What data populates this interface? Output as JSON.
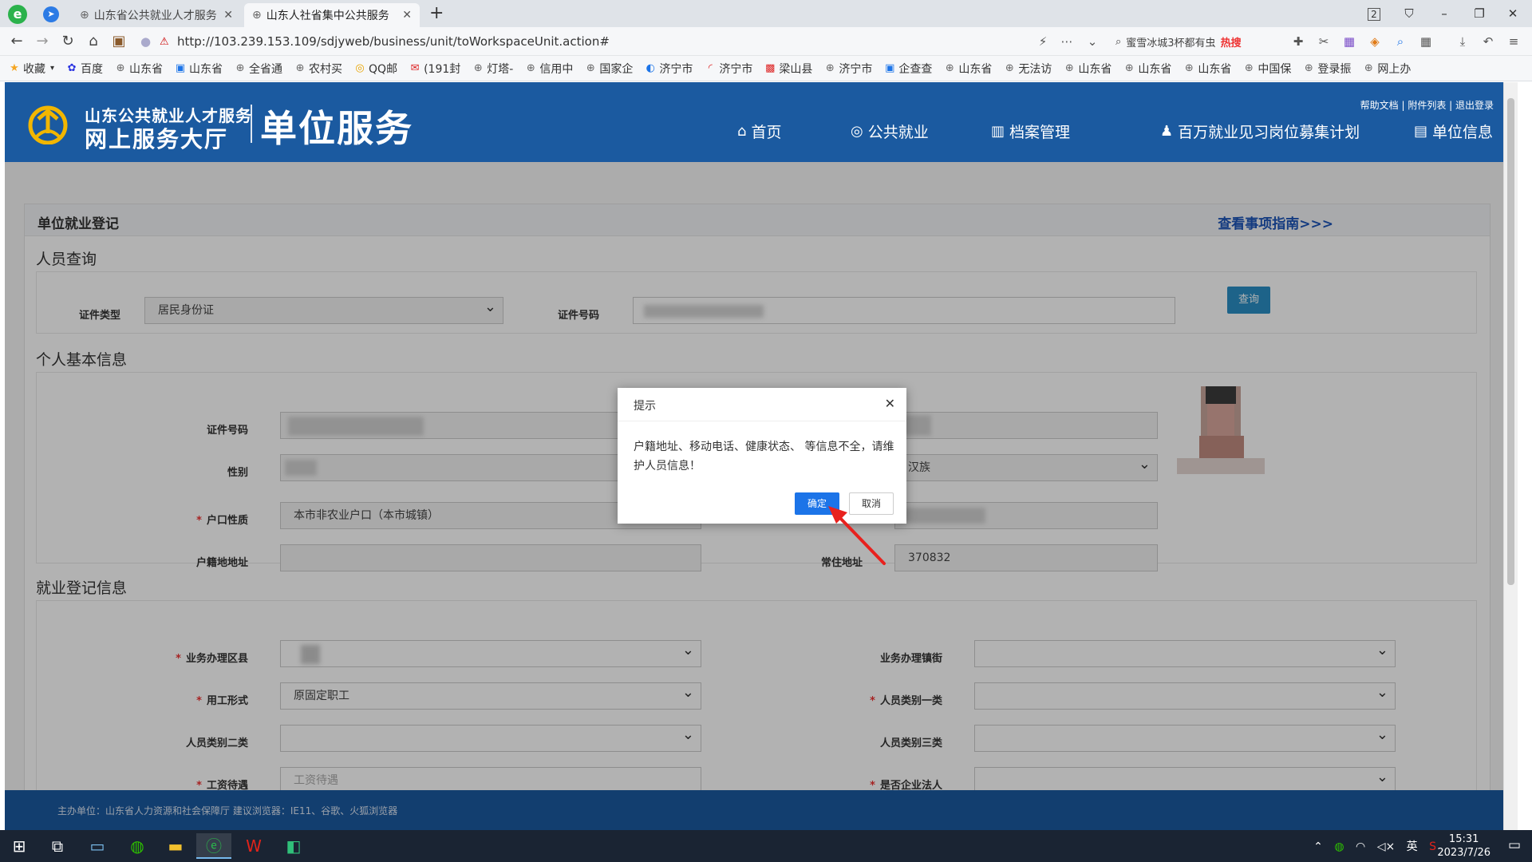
{
  "browser": {
    "tabs": [
      {
        "title": "山东省公共就业人才服务"
      },
      {
        "title": "山东人社省集中公共服务"
      }
    ],
    "window_counter": "2",
    "url": "http://103.239.153.109/sdjyweb/business/unit/toWorkspaceUnit.action#",
    "search_text": "蜜雪冰城3杯都有虫",
    "search_hot": "热搜",
    "bookmarks": [
      "收藏",
      "百度",
      "山东省",
      "山东省",
      "全省通",
      "农村买",
      "QQ邮",
      "(191封",
      "灯塔-",
      "信用中",
      "国家企",
      "济宁市",
      "济宁市",
      "梁山县",
      "济宁市",
      "企查查",
      "山东省",
      "无法访",
      "山东省",
      "山东省",
      "山东省",
      "中国保",
      "登录振",
      "网上办"
    ]
  },
  "site": {
    "logo_line1": "山东公共就业人才服务",
    "logo_line2": "网上服务大厅",
    "logo_unit": "单位服务",
    "top_links": "帮助文档 | 附件列表 | 退出登录",
    "nav": [
      "首页",
      "公共就业",
      "档案管理",
      "百万就业见习岗位募集计划",
      "单位信息"
    ],
    "footer": "主办单位：山东省人力资源和社会保障厅   建议浏览器：IE11、谷歌、火狐浏览器"
  },
  "panel": {
    "title": "单位就业登记",
    "guide_link": "查看事项指南>>>",
    "query_section": "人员查询",
    "id_type_label": "证件类型",
    "id_type_value": "居民身份证",
    "id_number_label": "证件号码",
    "query_button": "查询",
    "basic_section": "个人基本信息",
    "basic": {
      "id_number_label": "证件号码",
      "gender_label": "性别",
      "ethnicity_value": "汉族",
      "hukou_type_label": "户口性质",
      "hukou_type_value": "本市非农业户口（本市城镇）",
      "hukou_address_label": "户籍地地址",
      "residence_label": "常住地址",
      "residence_value": "370832"
    },
    "employment_section": "就业登记信息",
    "employment": {
      "district_label": "业务办理区县",
      "street_label": "业务办理镇街",
      "form_label": "用工形式",
      "form_value": "原固定职工",
      "cat1_label": "人员类别一类",
      "cat2_label": "人员类别二类",
      "cat3_label": "人员类别三类",
      "salary_label": "工资待遇",
      "salary_placeholder": "工资待遇",
      "legal_rep_label": "是否企业法人"
    }
  },
  "dialog": {
    "title": "提示",
    "message": "户籍地址、移动电话、健康状态、 等信息不全，请维护人员信息！",
    "ok": "确定",
    "cancel": "取消"
  },
  "taskbar": {
    "tray": "英",
    "time": "15:31",
    "date": "2023/7/26"
  },
  "colors": {
    "header_blue": "#1b5aa0",
    "button_blue": "#1c74e8",
    "required_red": "#e33"
  }
}
